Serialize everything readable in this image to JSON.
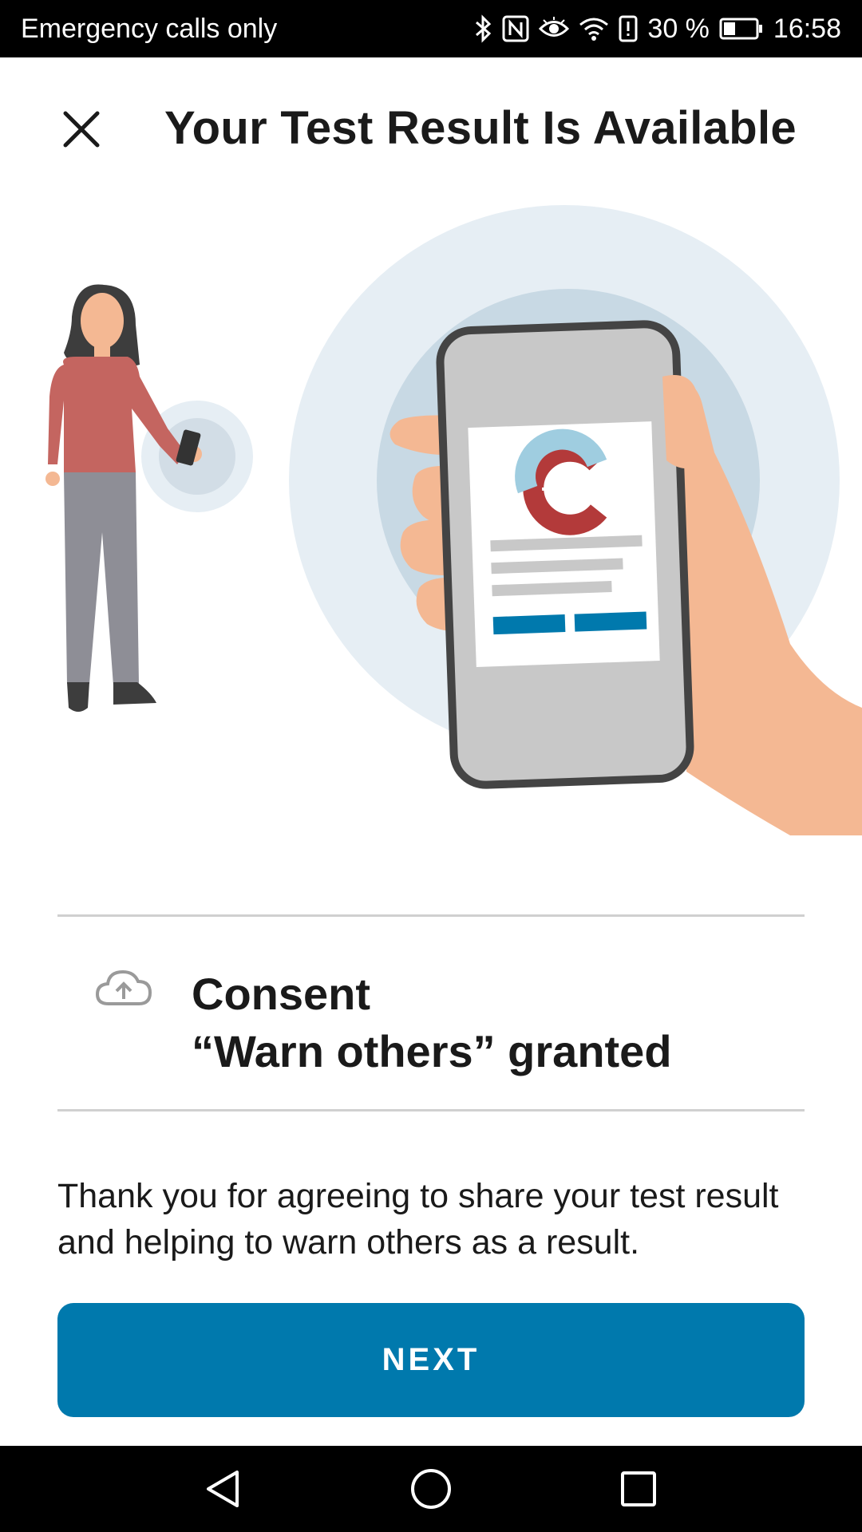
{
  "status_bar": {
    "carrier": "Emergency calls only",
    "battery_percent": "30 %",
    "time": "16:58",
    "icons": [
      "bluetooth-icon",
      "nfc-icon",
      "eye-icon",
      "wifi-icon",
      "alert-icon",
      "battery-icon"
    ]
  },
  "header": {
    "title": "Your Test Result Is Available",
    "close_icon": "close-icon"
  },
  "consent": {
    "line1": "Consent",
    "line2": "“Warn others” granted",
    "icon": "cloud-upload-icon"
  },
  "body": {
    "text": "Thank you for agreeing to share your test result and helping to warn others as a result."
  },
  "actions": {
    "next_label": "NEXT"
  },
  "colors": {
    "primary": "#0079ad",
    "skin": "#f4b893",
    "shirt": "#c46560",
    "pants": "#8e8e96"
  }
}
